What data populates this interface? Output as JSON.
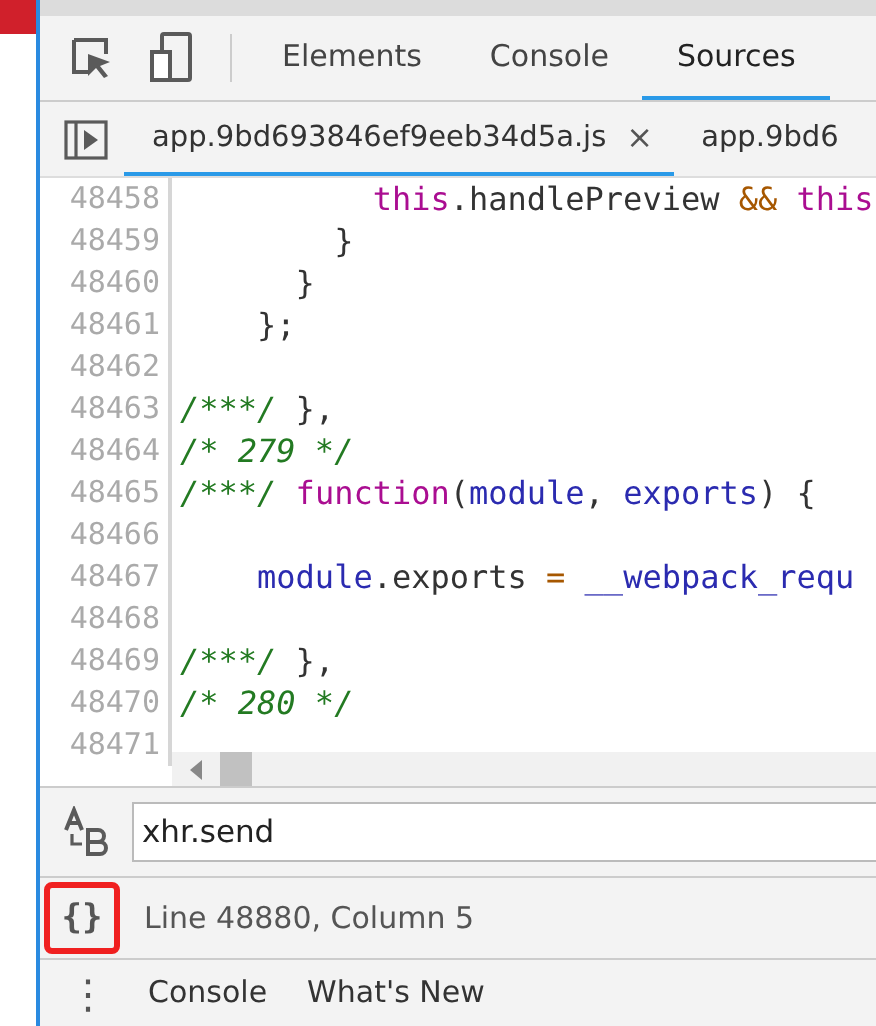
{
  "toolbar": {
    "tabs": [
      {
        "label": "Elements",
        "selected": false
      },
      {
        "label": "Console",
        "selected": false
      },
      {
        "label": "Sources",
        "selected": true
      }
    ]
  },
  "file_tabs": [
    {
      "label": "app.9bd693846ef9eeb34d5a.js",
      "selected": true,
      "close": "×"
    },
    {
      "label": "app.9bd6",
      "selected": false
    }
  ],
  "code": {
    "lines": [
      {
        "number": "48458",
        "tokens": [
          {
            "kind": "keyword",
            "text": "          this"
          },
          {
            "kind": "plain",
            "text": ".handlePreview "
          },
          {
            "kind": "operator",
            "text": "&& "
          },
          {
            "kind": "keyword",
            "text": "this"
          }
        ]
      },
      {
        "number": "48459",
        "tokens": [
          {
            "kind": "plain",
            "text": "        }"
          }
        ]
      },
      {
        "number": "48460",
        "tokens": [
          {
            "kind": "plain",
            "text": "      }"
          }
        ]
      },
      {
        "number": "48461",
        "tokens": [
          {
            "kind": "plain",
            "text": "    };"
          }
        ]
      },
      {
        "number": "48462"
      },
      {
        "number": "48463",
        "tokens": [
          {
            "kind": "comment",
            "text": "/***/"
          },
          {
            "kind": "plain",
            "text": " },"
          }
        ]
      },
      {
        "number": "48464",
        "tokens": [
          {
            "kind": "comment",
            "text": "/* 279 */"
          }
        ]
      },
      {
        "number": "48465",
        "tokens": [
          {
            "kind": "comment",
            "text": "/***/"
          },
          {
            "kind": "keyword",
            "text": " function"
          },
          {
            "kind": "plain",
            "text": "("
          },
          {
            "kind": "variable",
            "text": "module"
          },
          {
            "kind": "plain",
            "text": ", "
          },
          {
            "kind": "variable",
            "text": "exports"
          },
          {
            "kind": "plain",
            "text": ") {"
          }
        ]
      },
      {
        "number": "48466"
      },
      {
        "number": "48467",
        "tokens": [
          {
            "kind": "variable",
            "text": "    module"
          },
          {
            "kind": "plain",
            "text": ".exports "
          },
          {
            "kind": "operator",
            "text": "= "
          },
          {
            "kind": "variable",
            "text": "__webpack_requ"
          }
        ]
      },
      {
        "number": "48468"
      },
      {
        "number": "48469",
        "tokens": [
          {
            "kind": "comment",
            "text": "/***/"
          },
          {
            "kind": "plain",
            "text": " },"
          }
        ]
      },
      {
        "number": "48470",
        "tokens": [
          {
            "kind": "comment",
            "text": "/* 280 */"
          }
        ]
      },
      {
        "number": "48471"
      }
    ]
  },
  "search": {
    "value": "xhr.send"
  },
  "status": {
    "pretty_print": "{}",
    "highlighted": true,
    "text": "Line 48880, Column 5"
  },
  "drawer": {
    "menu": "⋮",
    "tabs": [
      {
        "label": "Console",
        "selected": false
      },
      {
        "label": "What's New",
        "selected": false
      }
    ]
  }
}
